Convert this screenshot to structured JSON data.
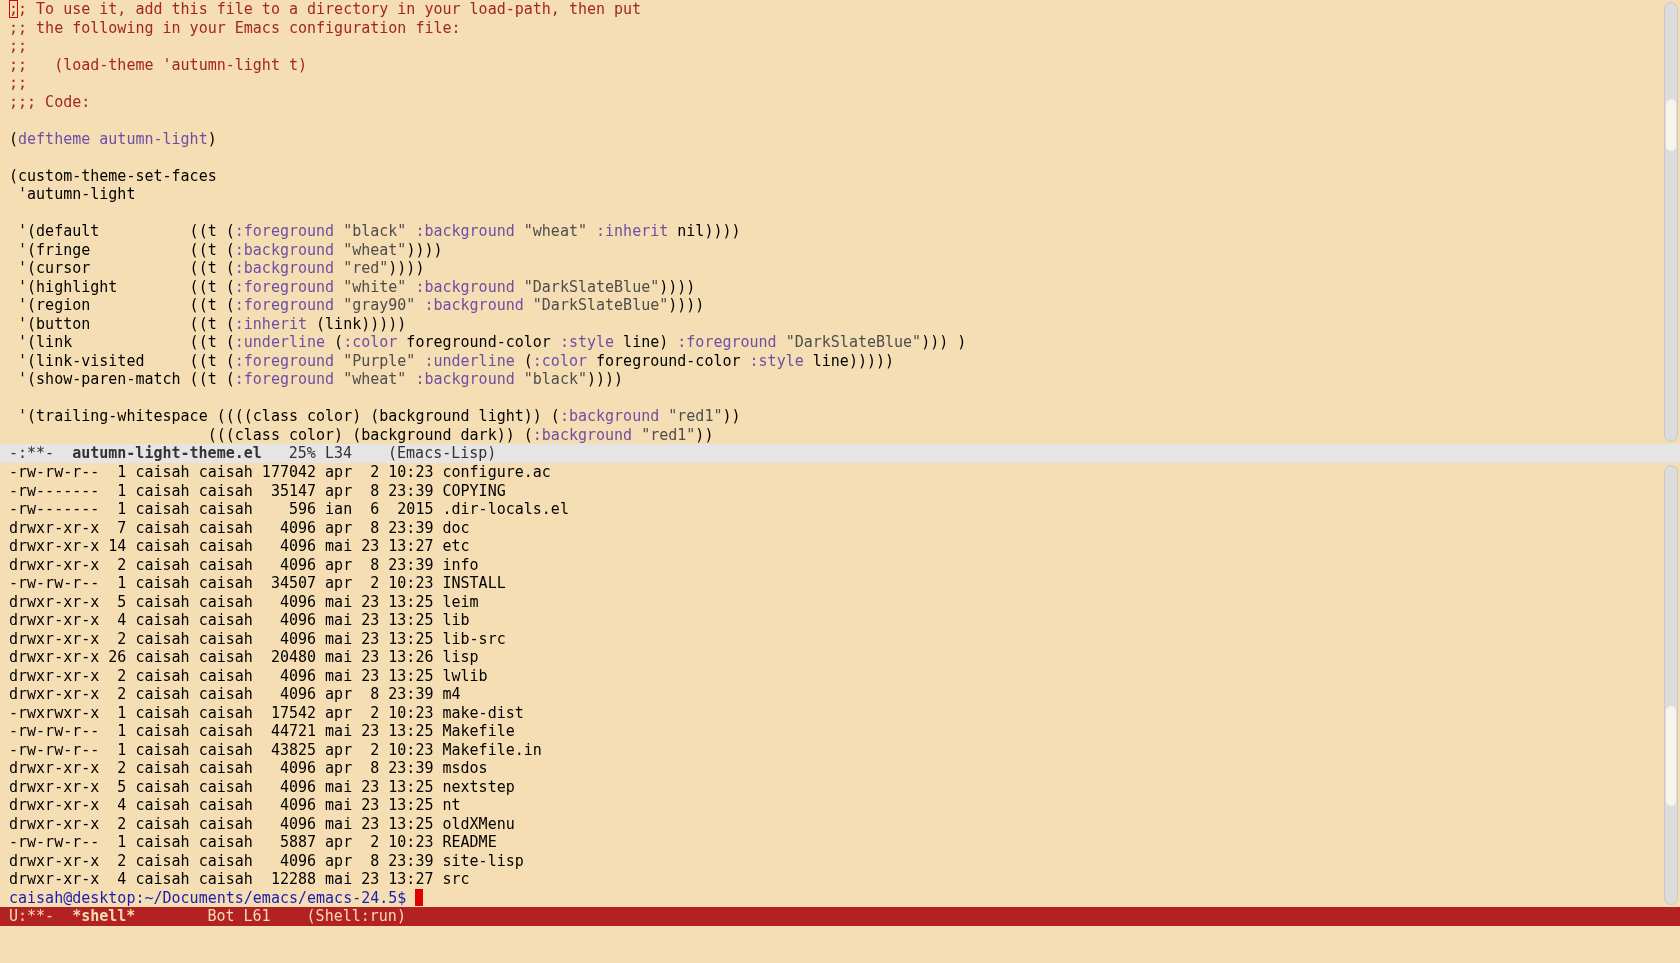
{
  "editor_window": {
    "active": false,
    "lines": [
      {
        "kind": "code",
        "segments": [
          {
            "kind": "cursor",
            "text": ";"
          },
          {
            "kind": "comment",
            "text": "; To use it, add this file to a directory in your load-path, then put"
          }
        ]
      },
      {
        "kind": "code",
        "segments": [
          {
            "kind": "comment",
            "text": ";; the following in your Emacs configuration file:"
          }
        ]
      },
      {
        "kind": "code",
        "segments": [
          {
            "kind": "comment",
            "text": ";;"
          }
        ]
      },
      {
        "kind": "code",
        "segments": [
          {
            "kind": "comment",
            "text": ";;   (load-theme 'autumn-light t)"
          }
        ]
      },
      {
        "kind": "code",
        "segments": [
          {
            "kind": "comment",
            "text": ";;"
          }
        ]
      },
      {
        "kind": "code",
        "segments": [
          {
            "kind": "comment",
            "text": ";;; Code:"
          }
        ]
      },
      {
        "kind": "blank"
      },
      {
        "kind": "code",
        "segments": [
          {
            "kind": "plain",
            "text": "("
          },
          {
            "kind": "keyword",
            "text": "deftheme"
          },
          {
            "kind": "name",
            "text": " autumn-light"
          },
          {
            "kind": "plain",
            "text": ")"
          }
        ]
      },
      {
        "kind": "blank"
      },
      {
        "kind": "code",
        "segments": [
          {
            "kind": "plain",
            "text": "(custom-theme-set-faces"
          }
        ]
      },
      {
        "kind": "code",
        "segments": [
          {
            "kind": "plain",
            "text": " 'autumn-light"
          }
        ]
      },
      {
        "kind": "blank"
      },
      {
        "kind": "code",
        "segments": [
          {
            "kind": "plain",
            "text": " '(default          ((t ("
          },
          {
            "kind": "keyword",
            "text": ":foreground"
          },
          {
            "kind": "string",
            "text": " \"black\" "
          },
          {
            "kind": "keyword",
            "text": ":background"
          },
          {
            "kind": "string",
            "text": " \"wheat\" "
          },
          {
            "kind": "keyword",
            "text": ":inherit"
          },
          {
            "kind": "plain",
            "text": " nil))))"
          }
        ]
      },
      {
        "kind": "code",
        "segments": [
          {
            "kind": "plain",
            "text": " '(fringe           ((t ("
          },
          {
            "kind": "keyword",
            "text": ":background"
          },
          {
            "kind": "string",
            "text": " \"wheat\""
          },
          {
            "kind": "plain",
            "text": "))))"
          }
        ]
      },
      {
        "kind": "code",
        "segments": [
          {
            "kind": "plain",
            "text": " '(cursor           ((t ("
          },
          {
            "kind": "keyword",
            "text": ":background"
          },
          {
            "kind": "string",
            "text": " \"red\""
          },
          {
            "kind": "plain",
            "text": "))))"
          }
        ]
      },
      {
        "kind": "code",
        "segments": [
          {
            "kind": "plain",
            "text": " '(highlight        ((t ("
          },
          {
            "kind": "keyword",
            "text": ":foreground"
          },
          {
            "kind": "string",
            "text": " \"white\" "
          },
          {
            "kind": "keyword",
            "text": ":background"
          },
          {
            "kind": "string",
            "text": " \"DarkSlateBlue\""
          },
          {
            "kind": "plain",
            "text": "))))"
          }
        ]
      },
      {
        "kind": "code",
        "segments": [
          {
            "kind": "plain",
            "text": " '(region           ((t ("
          },
          {
            "kind": "keyword",
            "text": ":foreground"
          },
          {
            "kind": "string",
            "text": " \"gray90\" "
          },
          {
            "kind": "keyword",
            "text": ":background"
          },
          {
            "kind": "string",
            "text": " \"DarkSlateBlue\""
          },
          {
            "kind": "plain",
            "text": "))))"
          }
        ]
      },
      {
        "kind": "code",
        "segments": [
          {
            "kind": "plain",
            "text": " '(button           ((t ("
          },
          {
            "kind": "keyword",
            "text": ":inherit"
          },
          {
            "kind": "plain",
            "text": " (link)))))"
          }
        ]
      },
      {
        "kind": "code",
        "segments": [
          {
            "kind": "plain",
            "text": " '(link             ((t ("
          },
          {
            "kind": "keyword",
            "text": ":underline"
          },
          {
            "kind": "plain",
            "text": " ("
          },
          {
            "kind": "keyword",
            "text": ":color"
          },
          {
            "kind": "plain",
            "text": " foreground-color "
          },
          {
            "kind": "keyword",
            "text": ":style"
          },
          {
            "kind": "plain",
            "text": " line) "
          },
          {
            "kind": "keyword",
            "text": ":foreground"
          },
          {
            "kind": "string",
            "text": " \"DarkSlateBlue\""
          },
          {
            "kind": "plain",
            "text": "))) )"
          }
        ]
      },
      {
        "kind": "code",
        "segments": [
          {
            "kind": "plain",
            "text": " '(link-visited     ((t ("
          },
          {
            "kind": "keyword",
            "text": ":foreground"
          },
          {
            "kind": "string",
            "text": " \"Purple\" "
          },
          {
            "kind": "keyword",
            "text": ":underline"
          },
          {
            "kind": "plain",
            "text": " ("
          },
          {
            "kind": "keyword",
            "text": ":color"
          },
          {
            "kind": "plain",
            "text": " foreground-color "
          },
          {
            "kind": "keyword",
            "text": ":style"
          },
          {
            "kind": "plain",
            "text": " line)))))"
          }
        ]
      },
      {
        "kind": "code",
        "segments": [
          {
            "kind": "plain",
            "text": " '(show-paren-match ((t ("
          },
          {
            "kind": "keyword",
            "text": ":foreground"
          },
          {
            "kind": "string",
            "text": " \"wheat\" "
          },
          {
            "kind": "keyword",
            "text": ":background"
          },
          {
            "kind": "string",
            "text": " \"black\""
          },
          {
            "kind": "plain",
            "text": "))))"
          }
        ]
      },
      {
        "kind": "blank"
      },
      {
        "kind": "code",
        "segments": [
          {
            "kind": "plain",
            "text": " '(trailing-whitespace ((((class color) (background light)) ("
          },
          {
            "kind": "keyword",
            "text": ":background"
          },
          {
            "kind": "string",
            "text": " \"red1\""
          },
          {
            "kind": "plain",
            "text": "))"
          }
        ]
      },
      {
        "kind": "code",
        "segments": [
          {
            "kind": "plain",
            "text": "                      (((class color) (background dark)) ("
          },
          {
            "kind": "keyword",
            "text": ":background"
          },
          {
            "kind": "string",
            "text": " \"red1\""
          },
          {
            "kind": "plain",
            "text": "))"
          }
        ]
      }
    ],
    "mode_line": {
      "status": "-:**-",
      "buffer_name": "autumn-light-theme.el",
      "position": "25% L34",
      "mode": "(Emacs-Lisp)"
    }
  },
  "shell_window": {
    "active": true,
    "listing": [
      "-rw-rw-r--  1 caisah caisah 177042 apr  2 10:23 configure.ac",
      "-rw-------  1 caisah caisah  35147 apr  8 23:39 COPYING",
      "-rw-------  1 caisah caisah    596 ian  6  2015 .dir-locals.el",
      "drwxr-xr-x  7 caisah caisah   4096 apr  8 23:39 doc",
      "drwxr-xr-x 14 caisah caisah   4096 mai 23 13:27 etc",
      "drwxr-xr-x  2 caisah caisah   4096 apr  8 23:39 info",
      "-rw-rw-r--  1 caisah caisah  34507 apr  2 10:23 INSTALL",
      "drwxr-xr-x  5 caisah caisah   4096 mai 23 13:25 leim",
      "drwxr-xr-x  4 caisah caisah   4096 mai 23 13:25 lib",
      "drwxr-xr-x  2 caisah caisah   4096 mai 23 13:25 lib-src",
      "drwxr-xr-x 26 caisah caisah  20480 mai 23 13:26 lisp",
      "drwxr-xr-x  2 caisah caisah   4096 mai 23 13:25 lwlib",
      "drwxr-xr-x  2 caisah caisah   4096 apr  8 23:39 m4",
      "-rwxrwxr-x  1 caisah caisah  17542 apr  2 10:23 make-dist",
      "-rw-rw-r--  1 caisah caisah  44721 mai 23 13:25 Makefile",
      "-rw-rw-r--  1 caisah caisah  43825 apr  2 10:23 Makefile.in",
      "drwxr-xr-x  2 caisah caisah   4096 apr  8 23:39 msdos",
      "drwxr-xr-x  5 caisah caisah   4096 mai 23 13:25 nextstep",
      "drwxr-xr-x  4 caisah caisah   4096 mai 23 13:25 nt",
      "drwxr-xr-x  2 caisah caisah   4096 mai 23 13:25 oldXMenu",
      "-rw-rw-r--  1 caisah caisah   5887 apr  2 10:23 README",
      "drwxr-xr-x  2 caisah caisah   4096 apr  8 23:39 site-lisp",
      "drwxr-xr-x  4 caisah caisah  12288 mai 23 13:27 src"
    ],
    "prompt": "caisah@desktop:~/Documents/emacs/emacs-24.5$",
    "mode_line": {
      "status": "U:**-",
      "buffer_name": "*shell*",
      "position": "Bot L61",
      "mode": "(Shell:run)"
    }
  }
}
